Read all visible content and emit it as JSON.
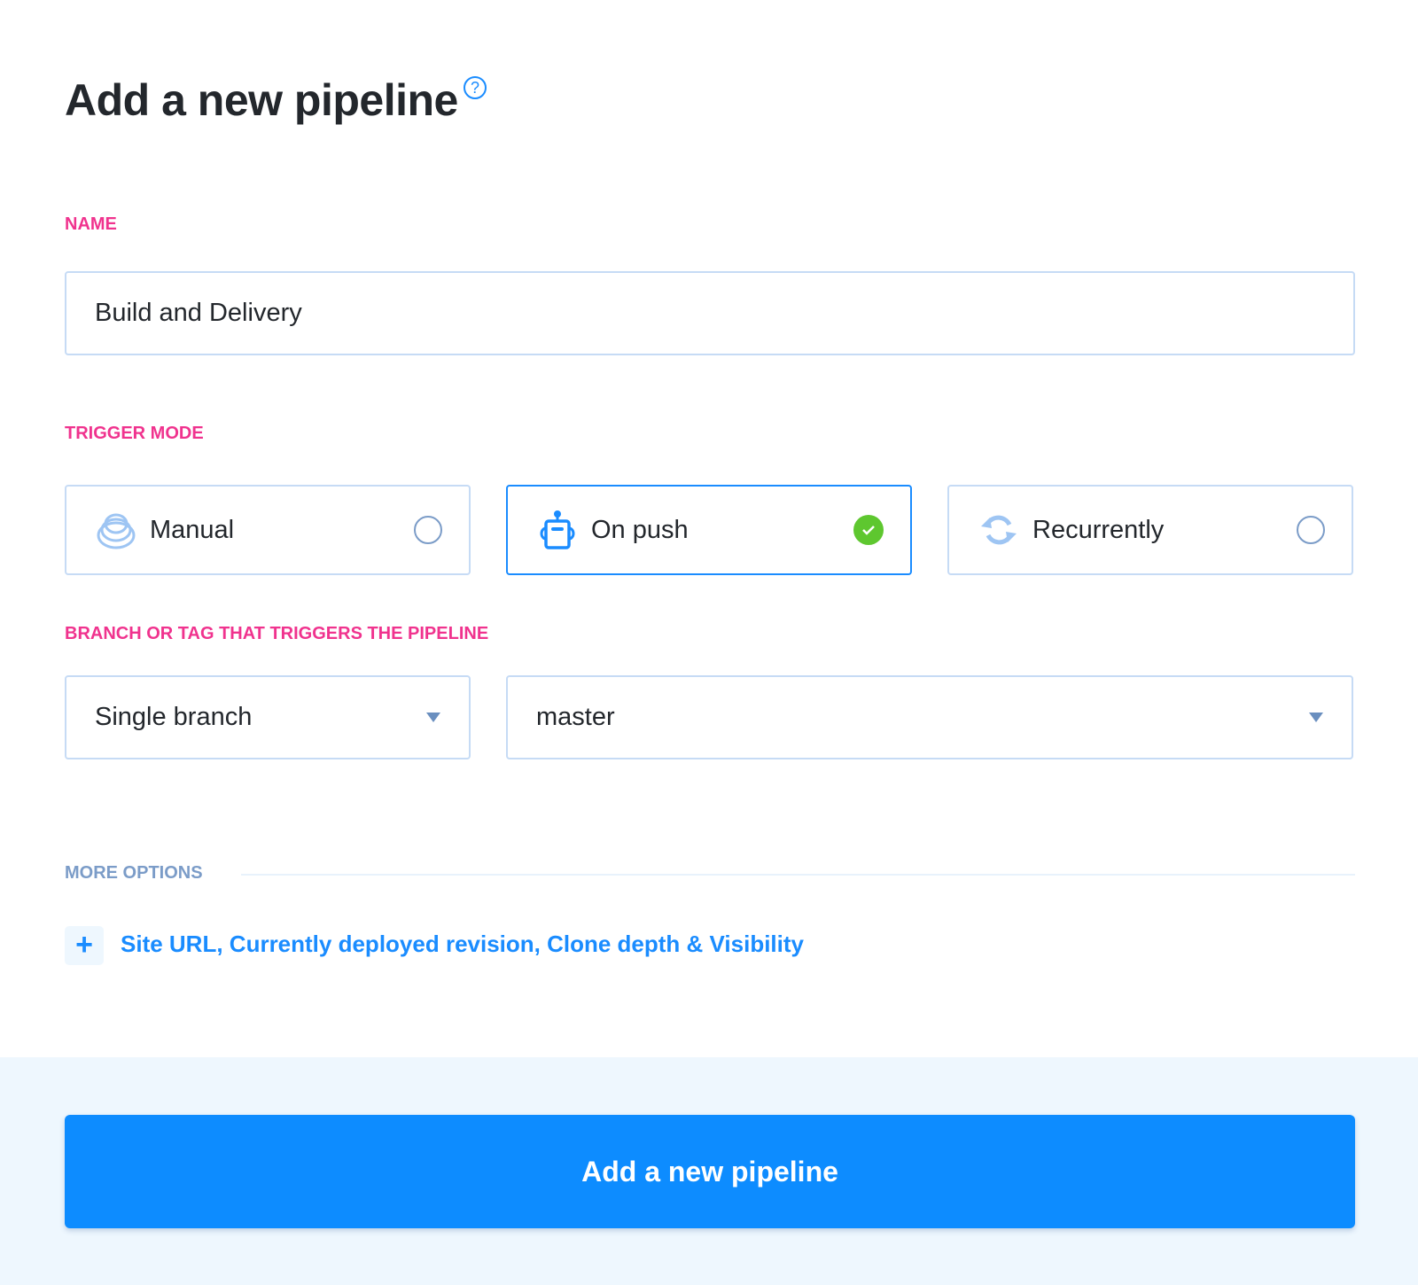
{
  "header": {
    "title": "Add a new pipeline",
    "help_icon": "question-circle-icon"
  },
  "name_field": {
    "label": "NAME",
    "value": "Build and Delivery"
  },
  "trigger": {
    "label": "TRIGGER MODE",
    "options": [
      {
        "label": "Manual",
        "icon": "hand-stack-icon",
        "selected": false
      },
      {
        "label": "On push",
        "icon": "robot-icon",
        "selected": true
      },
      {
        "label": "Recurrently",
        "icon": "refresh-icon",
        "selected": false
      }
    ]
  },
  "branch": {
    "label": "BRANCH OR TAG THAT TRIGGERS THE PIPELINE",
    "mode": "Single branch",
    "branch": "master"
  },
  "more_options": {
    "label": "MORE OPTIONS",
    "link": "Site URL, Currently deployed revision, Clone depth & Visibility"
  },
  "submit": {
    "label": "Add a new pipeline"
  },
  "colors": {
    "accent": "#0d8cff",
    "label": "#f0338e",
    "success": "#5ec72f"
  }
}
